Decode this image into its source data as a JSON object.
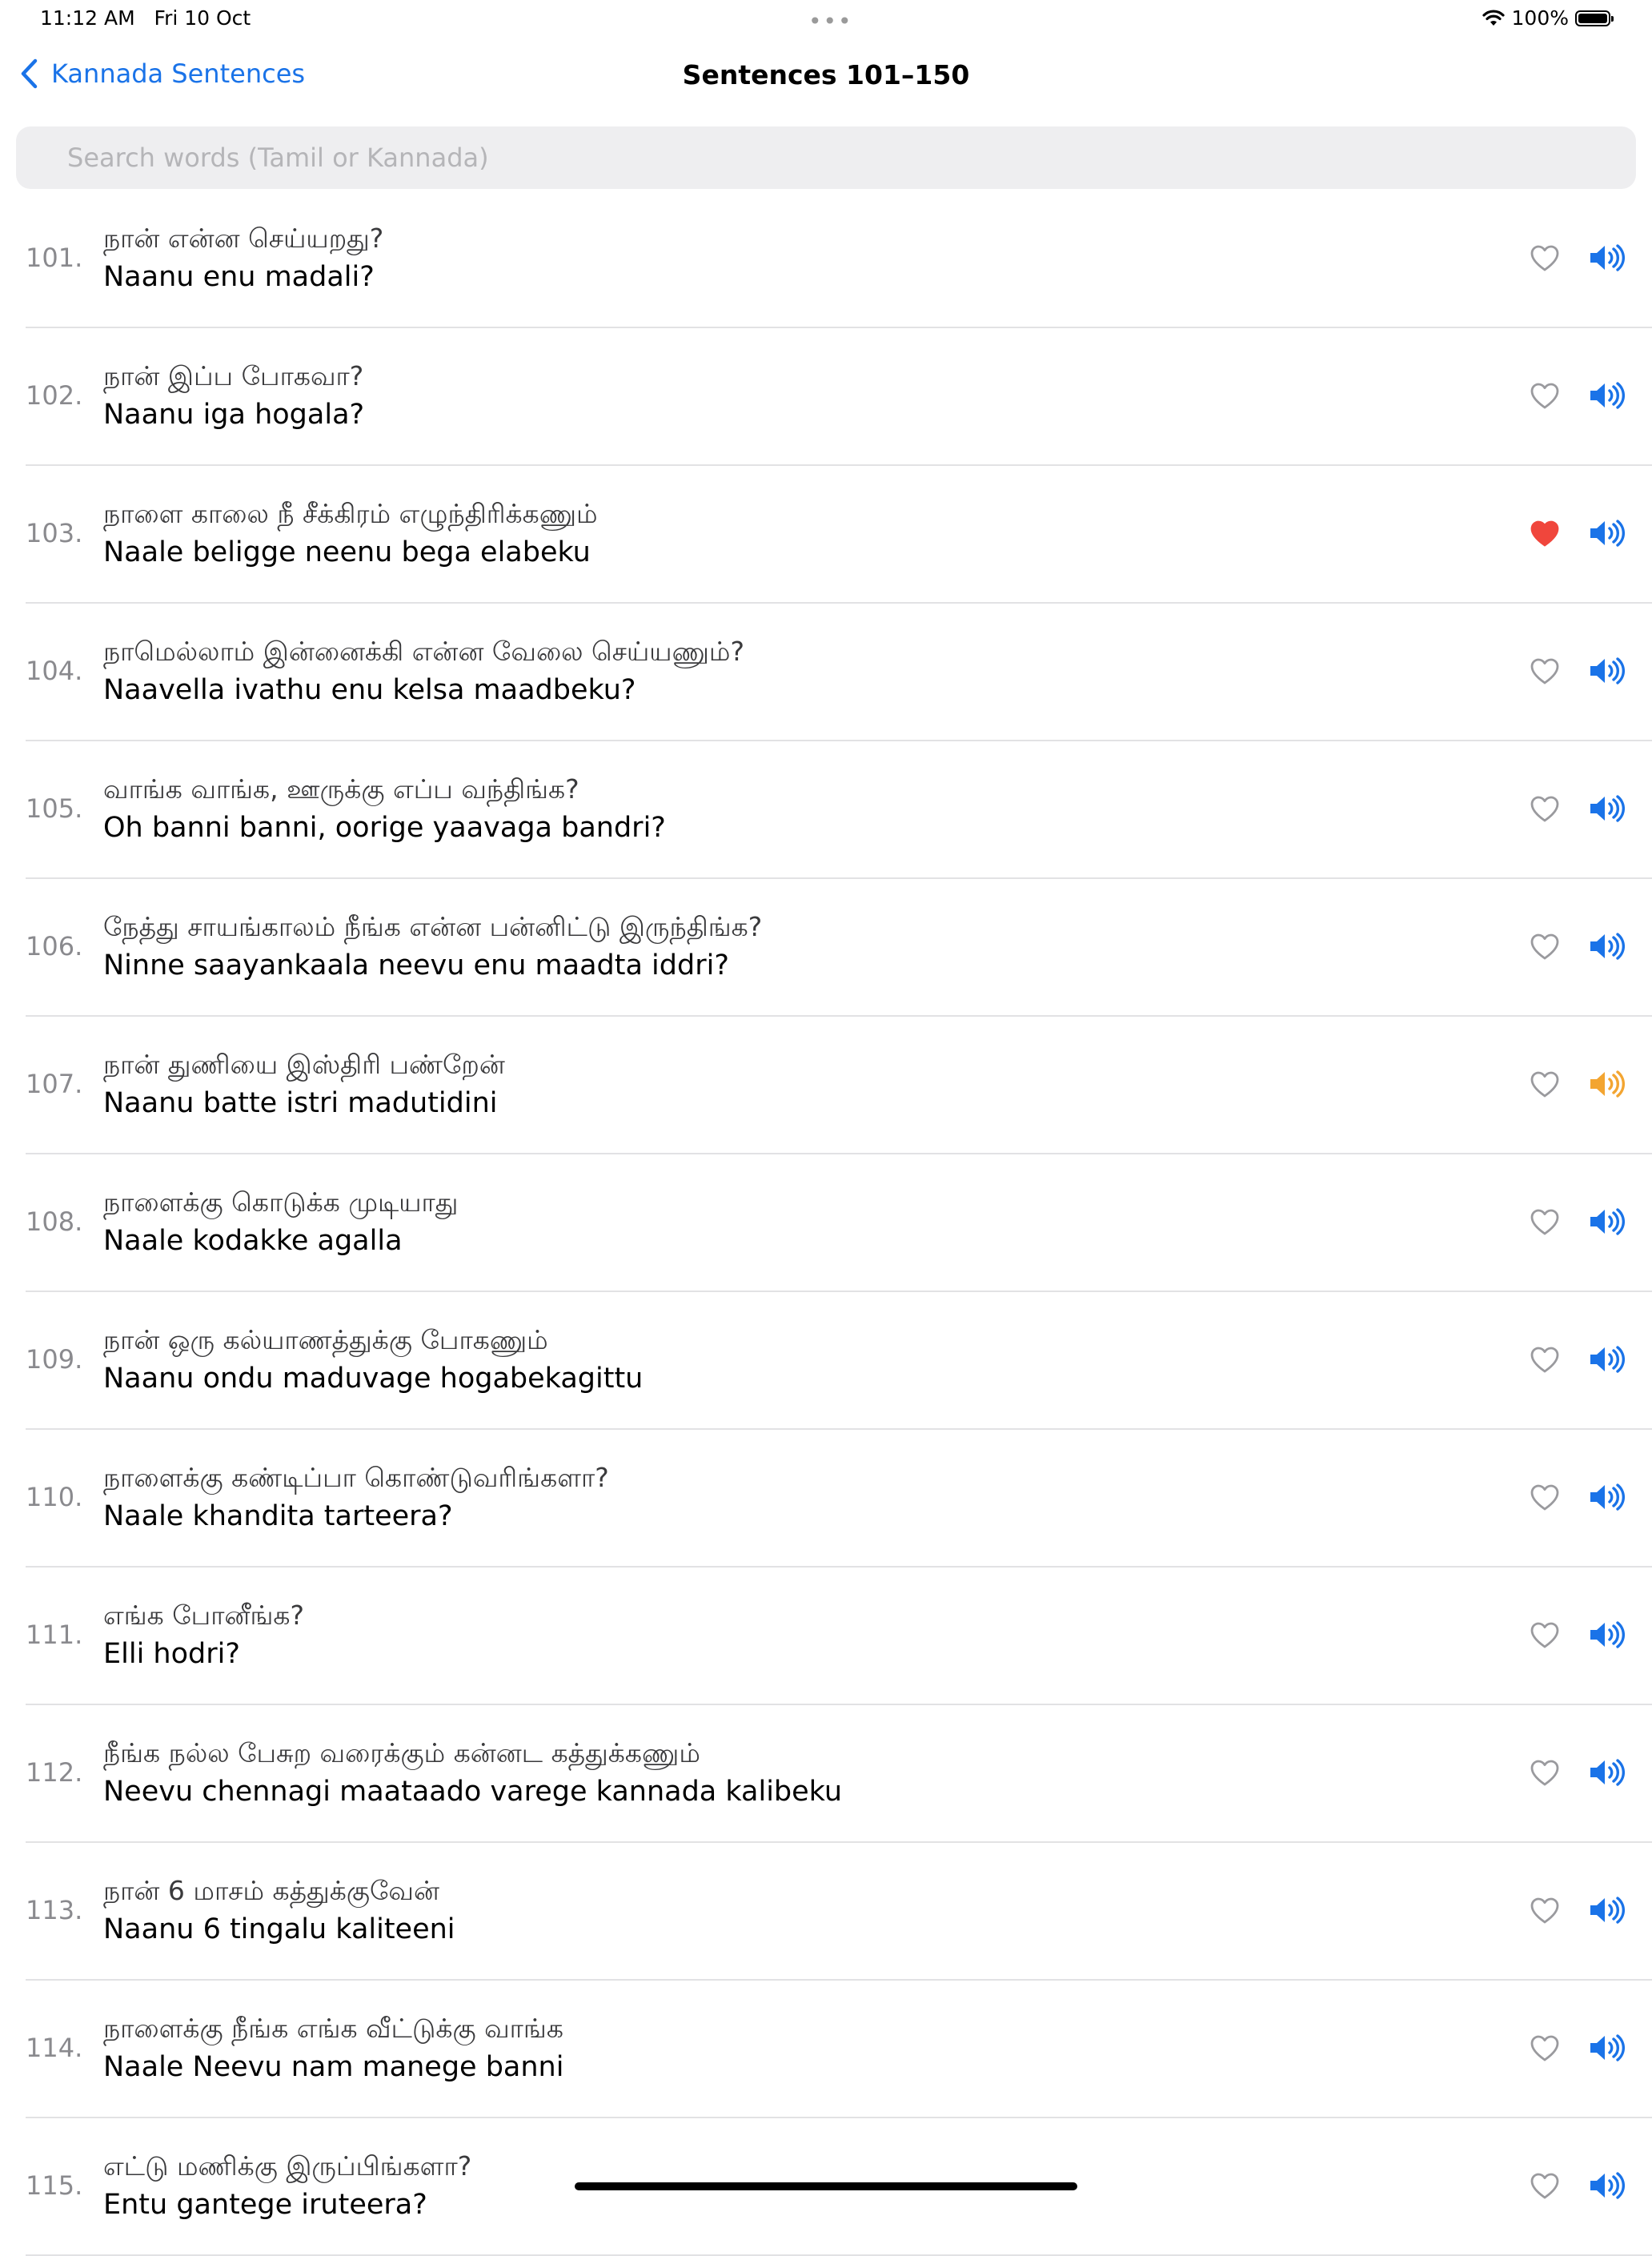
{
  "status_bar": {
    "time": "11:12 AM",
    "date": "Fri 10 Oct",
    "battery_text": "100%",
    "battery_level": 1.0,
    "icons": [
      "wifi-icon",
      "battery-icon"
    ]
  },
  "nav": {
    "back_label": "Kannada Sentences",
    "title": "Sentences 101–150",
    "back_icon": "chevron-left-icon"
  },
  "search": {
    "placeholder": "Search words (Tamil or Kannada)",
    "value": ""
  },
  "colors": {
    "accent": "#1a73e8",
    "favorite_on": "#f0463c",
    "favorite_off": "#9a9a9e",
    "speaking": "#f3a531"
  },
  "sentences": [
    {
      "number": "101.",
      "tamil": "நான் என்ன செய்யறது?",
      "kannada": "Naanu enu madali?",
      "favorite": false,
      "speaking": false
    },
    {
      "number": "102.",
      "tamil": "நான் இப்ப போகவா?",
      "kannada": "Naanu iga hogala?",
      "favorite": false,
      "speaking": false
    },
    {
      "number": "103.",
      "tamil": "நாளை காலை நீ சீக்கிரம் எழுந்திரிக்கணும்",
      "kannada": "Naale beligge neenu bega elabeku",
      "favorite": true,
      "speaking": false
    },
    {
      "number": "104.",
      "tamil": "நாமெல்லாம் இன்னைக்கி என்ன வேலை செய்யணும்?",
      "kannada": "Naavella ivathu enu kelsa maadbeku?",
      "favorite": false,
      "speaking": false
    },
    {
      "number": "105.",
      "tamil": "வாங்க வாங்க, ஊருக்கு எப்ப வந்திங்க?",
      "kannada": "Oh banni banni, oorige yaavaga bandri?",
      "favorite": false,
      "speaking": false
    },
    {
      "number": "106.",
      "tamil": "நேத்து சாயங்காலம் நீங்க என்ன பன்னிட்டு இருந்திங்க?",
      "kannada": "Ninne saayankaala neevu enu maadta iddri?",
      "favorite": false,
      "speaking": false
    },
    {
      "number": "107.",
      "tamil": "நான் துணியை இஸ்திரி பண்றேன்",
      "kannada": "Naanu batte istri madutidini",
      "favorite": false,
      "speaking": true
    },
    {
      "number": "108.",
      "tamil": "நாளைக்கு கொடுக்க முடியாது",
      "kannada": "Naale kodakke agalla",
      "favorite": false,
      "speaking": false
    },
    {
      "number": "109.",
      "tamil": "நான் ஒரு கல்யாணத்துக்கு போகணும்",
      "kannada": "Naanu ondu maduvage hogabekagittu",
      "favorite": false,
      "speaking": false
    },
    {
      "number": "110.",
      "tamil": "நாளைக்கு கண்டிப்பா கொண்டுவரிங்களா?",
      "kannada": "Naale khandita tarteera?",
      "favorite": false,
      "speaking": false
    },
    {
      "number": "111.",
      "tamil": "எங்க போனீங்க?",
      "kannada": "Elli hodri?",
      "favorite": false,
      "speaking": false
    },
    {
      "number": "112.",
      "tamil": "நீங்க நல்ல பேசுற வரைக்கும் கன்னட கத்துக்கணும்",
      "kannada": "Neevu chennagi maataado varege kannada kalibeku",
      "favorite": false,
      "speaking": false
    },
    {
      "number": "113.",
      "tamil": "நான் 6 மாசம் கத்துக்குவேன்",
      "kannada": "Naanu 6 tingalu kaliteeni",
      "favorite": false,
      "speaking": false
    },
    {
      "number": "114.",
      "tamil": "நாளைக்கு நீங்க எங்க வீட்டுக்கு வாங்க",
      "kannada": "Naale Neevu nam manege banni",
      "favorite": false,
      "speaking": false
    },
    {
      "number": "115.",
      "tamil": "எட்டு மணிக்கு இருப்பிங்களா?",
      "kannada": "Entu gantege iruteera?",
      "favorite": false,
      "speaking": false
    }
  ]
}
